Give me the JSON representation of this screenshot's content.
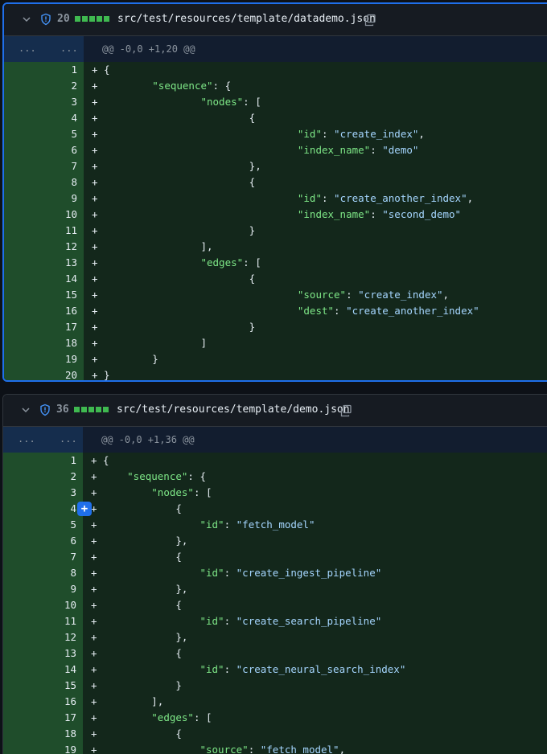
{
  "files": [
    {
      "count": "20",
      "path": "src/test/resources/template/datademo.json",
      "hunk": "@@ -0,0 +1,20 @@",
      "dots_old": "...",
      "dots_new": "...",
      "lines": [
        {
          "n": "1",
          "code": "+ {"
        },
        {
          "n": "2",
          "code": "+         \"sequence\": {"
        },
        {
          "n": "3",
          "code": "+                 \"nodes\": ["
        },
        {
          "n": "4",
          "code": "+                         {"
        },
        {
          "n": "5",
          "code": "+                                 \"id\": \"create_index\","
        },
        {
          "n": "6",
          "code": "+                                 \"index_name\": \"demo\""
        },
        {
          "n": "7",
          "code": "+                         },"
        },
        {
          "n": "8",
          "code": "+                         {"
        },
        {
          "n": "9",
          "code": "+                                 \"id\": \"create_another_index\","
        },
        {
          "n": "10",
          "code": "+                                 \"index_name\": \"second_demo\""
        },
        {
          "n": "11",
          "code": "+                         }"
        },
        {
          "n": "12",
          "code": "+                 ],"
        },
        {
          "n": "13",
          "code": "+                 \"edges\": ["
        },
        {
          "n": "14",
          "code": "+                         {"
        },
        {
          "n": "15",
          "code": "+                                 \"source\": \"create_index\","
        },
        {
          "n": "16",
          "code": "+                                 \"dest\": \"create_another_index\""
        },
        {
          "n": "17",
          "code": "+                         }"
        },
        {
          "n": "18",
          "code": "+                 ]"
        },
        {
          "n": "19",
          "code": "+         }"
        },
        {
          "n": "20",
          "code": "+ }"
        }
      ]
    },
    {
      "count": "36",
      "path": "src/test/resources/template/demo.json",
      "hunk": "@@ -0,0 +1,36 @@",
      "dots_old": "...",
      "dots_new": "...",
      "add_comment_glyph": "+",
      "lines": [
        {
          "n": "1",
          "code": "+ {"
        },
        {
          "n": "2",
          "code": "+     \"sequence\": {"
        },
        {
          "n": "3",
          "code": "+         \"nodes\": ["
        },
        {
          "n": "4",
          "code": "+             {"
        },
        {
          "n": "5",
          "code": "+                 \"id\": \"fetch_model\""
        },
        {
          "n": "6",
          "code": "+             },"
        },
        {
          "n": "7",
          "code": "+             {"
        },
        {
          "n": "8",
          "code": "+                 \"id\": \"create_ingest_pipeline\""
        },
        {
          "n": "9",
          "code": "+             },"
        },
        {
          "n": "10",
          "code": "+             {"
        },
        {
          "n": "11",
          "code": "+                 \"id\": \"create_search_pipeline\""
        },
        {
          "n": "12",
          "code": "+             },"
        },
        {
          "n": "13",
          "code": "+             {"
        },
        {
          "n": "14",
          "code": "+                 \"id\": \"create_neural_search_index\""
        },
        {
          "n": "15",
          "code": "+             }"
        },
        {
          "n": "16",
          "code": "+         ],"
        },
        {
          "n": "17",
          "code": "+         \"edges\": ["
        },
        {
          "n": "18",
          "code": "+             {"
        },
        {
          "n": "19",
          "code": "+                 \"source\": \"fetch_model\","
        }
      ]
    }
  ],
  "icons": {
    "collapse": "chevron-down-icon",
    "security": "shield-icon",
    "copy": "copy-icon"
  },
  "colors": {
    "addition_gutter": "#1f4d2b",
    "addition_code": "#13271b",
    "json_key": "#7ee787",
    "json_string": "#a5d6ff",
    "focus_border": "#1f6feb"
  }
}
